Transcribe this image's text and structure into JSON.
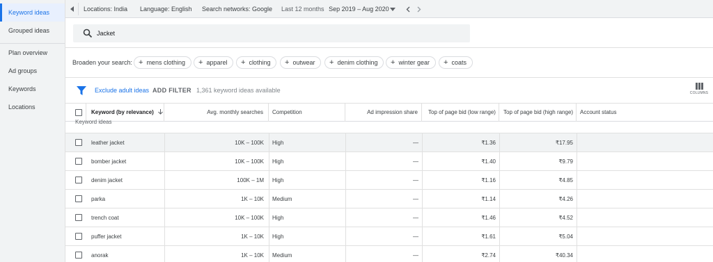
{
  "sidebar": {
    "items": [
      {
        "label": "Keyword ideas",
        "active": true
      },
      {
        "label": "Grouped ideas",
        "active": false
      },
      {
        "label": "Plan overview",
        "active": false
      },
      {
        "label": "Ad groups",
        "active": false
      },
      {
        "label": "Keywords",
        "active": false
      },
      {
        "label": "Locations",
        "active": false
      }
    ]
  },
  "topbar": {
    "locations": "Locations: India",
    "language": "Language: English",
    "networks": "Search networks: Google",
    "range_label": "Last 12 months",
    "range_value": "Sep 2019 – Aug 2020"
  },
  "search": {
    "value": "Jacket"
  },
  "broaden": {
    "label": "Broaden your search:",
    "chips": [
      "mens clothing",
      "apparel",
      "clothing",
      "outwear",
      "denim clothing",
      "winter gear",
      "coats"
    ]
  },
  "filterbar": {
    "exclude_link": "Exclude adult ideas",
    "add_filter": "ADD FILTER",
    "count_text": "1,361 keyword ideas available",
    "columns_label": "COLUMNS"
  },
  "table": {
    "headers": {
      "keyword": "Keyword (by relevance)",
      "searches": "Avg. monthly searches",
      "competition": "Competition",
      "impression": "Ad impression share",
      "bid_low": "Top of page bid (low range)",
      "bid_high": "Top of page bid (high range)",
      "status": "Account status"
    },
    "group_label": "Keyword ideas",
    "rows": [
      {
        "keyword": "leather jacket",
        "searches": "10K – 100K",
        "competition": "High",
        "impression": "—",
        "bid_low": "₹1.36",
        "bid_high": "₹17.95"
      },
      {
        "keyword": "bomber jacket",
        "searches": "10K – 100K",
        "competition": "High",
        "impression": "—",
        "bid_low": "₹1.40",
        "bid_high": "₹9.79"
      },
      {
        "keyword": "denim jacket",
        "searches": "100K – 1M",
        "competition": "High",
        "impression": "—",
        "bid_low": "₹1.16",
        "bid_high": "₹4.85"
      },
      {
        "keyword": "parka",
        "searches": "1K – 10K",
        "competition": "Medium",
        "impression": "—",
        "bid_low": "₹1.14",
        "bid_high": "₹4.26"
      },
      {
        "keyword": "trench coat",
        "searches": "10K – 100K",
        "competition": "High",
        "impression": "—",
        "bid_low": "₹1.46",
        "bid_high": "₹4.52"
      },
      {
        "keyword": "puffer jacket",
        "searches": "1K – 10K",
        "competition": "High",
        "impression": "—",
        "bid_low": "₹1.61",
        "bid_high": "₹5.04"
      },
      {
        "keyword": "anorak",
        "searches": "1K – 10K",
        "competition": "Medium",
        "impression": "—",
        "bid_low": "₹2.74",
        "bid_high": "₹40.34"
      }
    ]
  },
  "colors": {
    "accent": "#1a73e8",
    "active_bg": "#e8f0fe",
    "panel": "#f1f3f4"
  }
}
